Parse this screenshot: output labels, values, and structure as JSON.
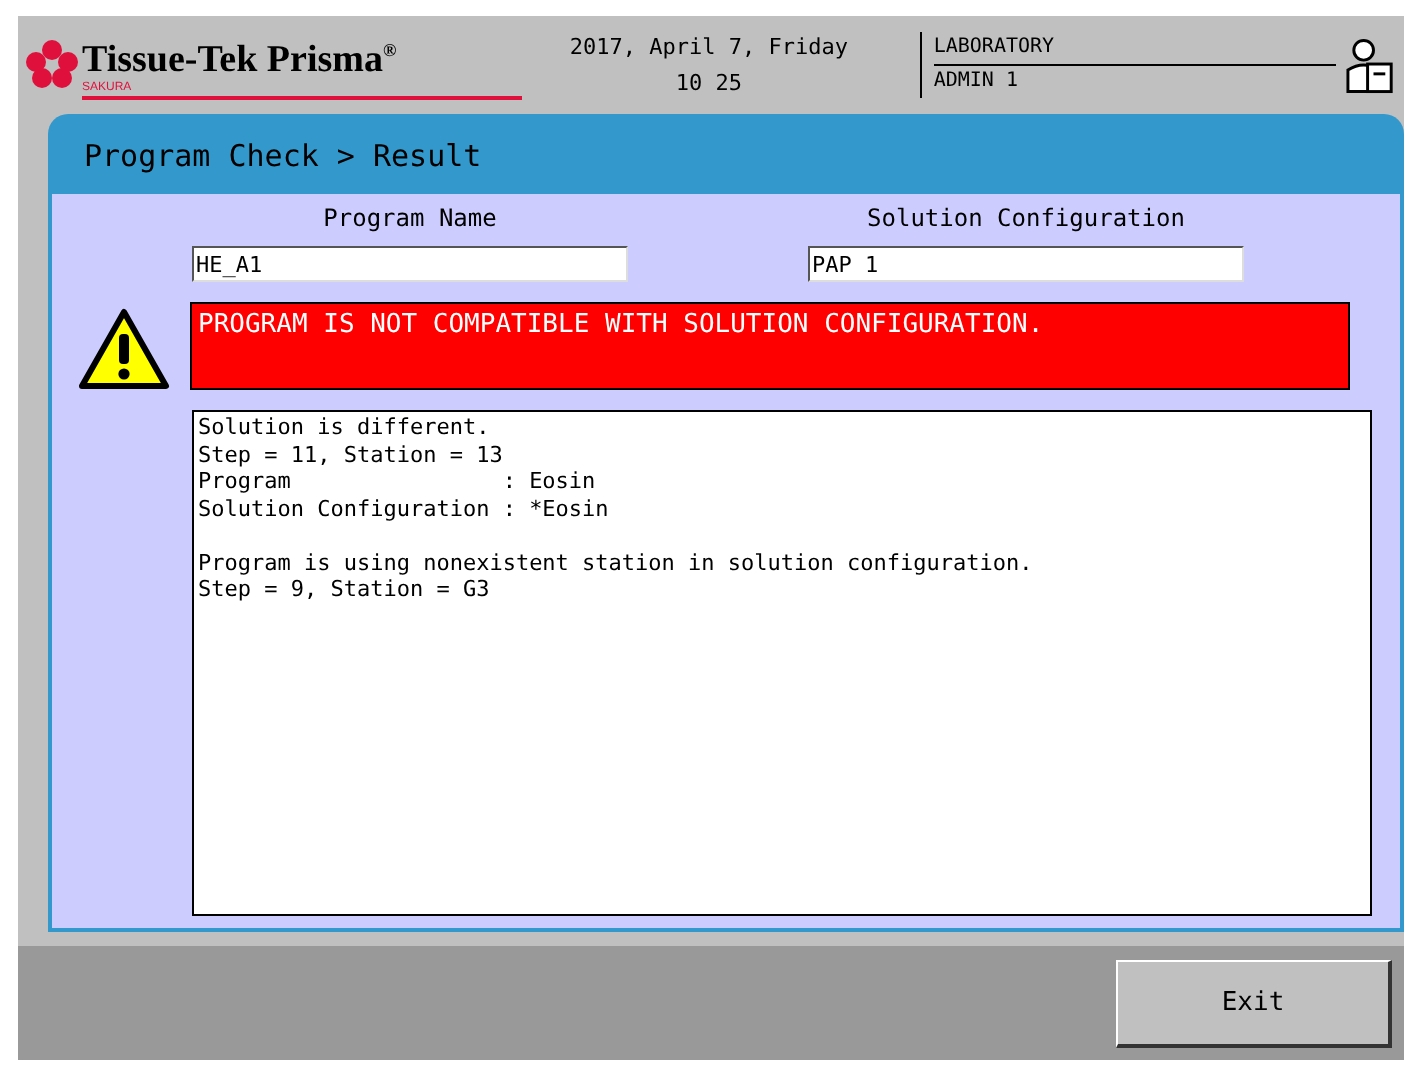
{
  "header": {
    "brand": "Tissue-Tek Prisma",
    "brand_mark": "®",
    "sub_brand": "SAKURA",
    "date": "2017, April 7, Friday",
    "time": "10 25",
    "location": "LABORATORY",
    "user": "ADMIN 1"
  },
  "panel": {
    "title": "Program Check > Result",
    "fields": [
      {
        "label": "Program Name",
        "value": "HE_A1"
      },
      {
        "label": "Solution Configuration",
        "value": "PAP 1"
      }
    ],
    "alert": "PROGRAM IS NOT COMPATIBLE WITH SOLUTION CONFIGURATION.",
    "details": [
      {
        "lines": [
          "Solution is different.",
          "Step = 11, Station = 13",
          "Program                : Eosin",
          "Solution Configuration : *Eosin"
        ]
      },
      {
        "lines": [
          "Program is using nonexistent station in solution configuration.",
          "Step = 9, Station = G3"
        ]
      }
    ]
  },
  "buttons": [
    {
      "label": "Exit"
    }
  ]
}
